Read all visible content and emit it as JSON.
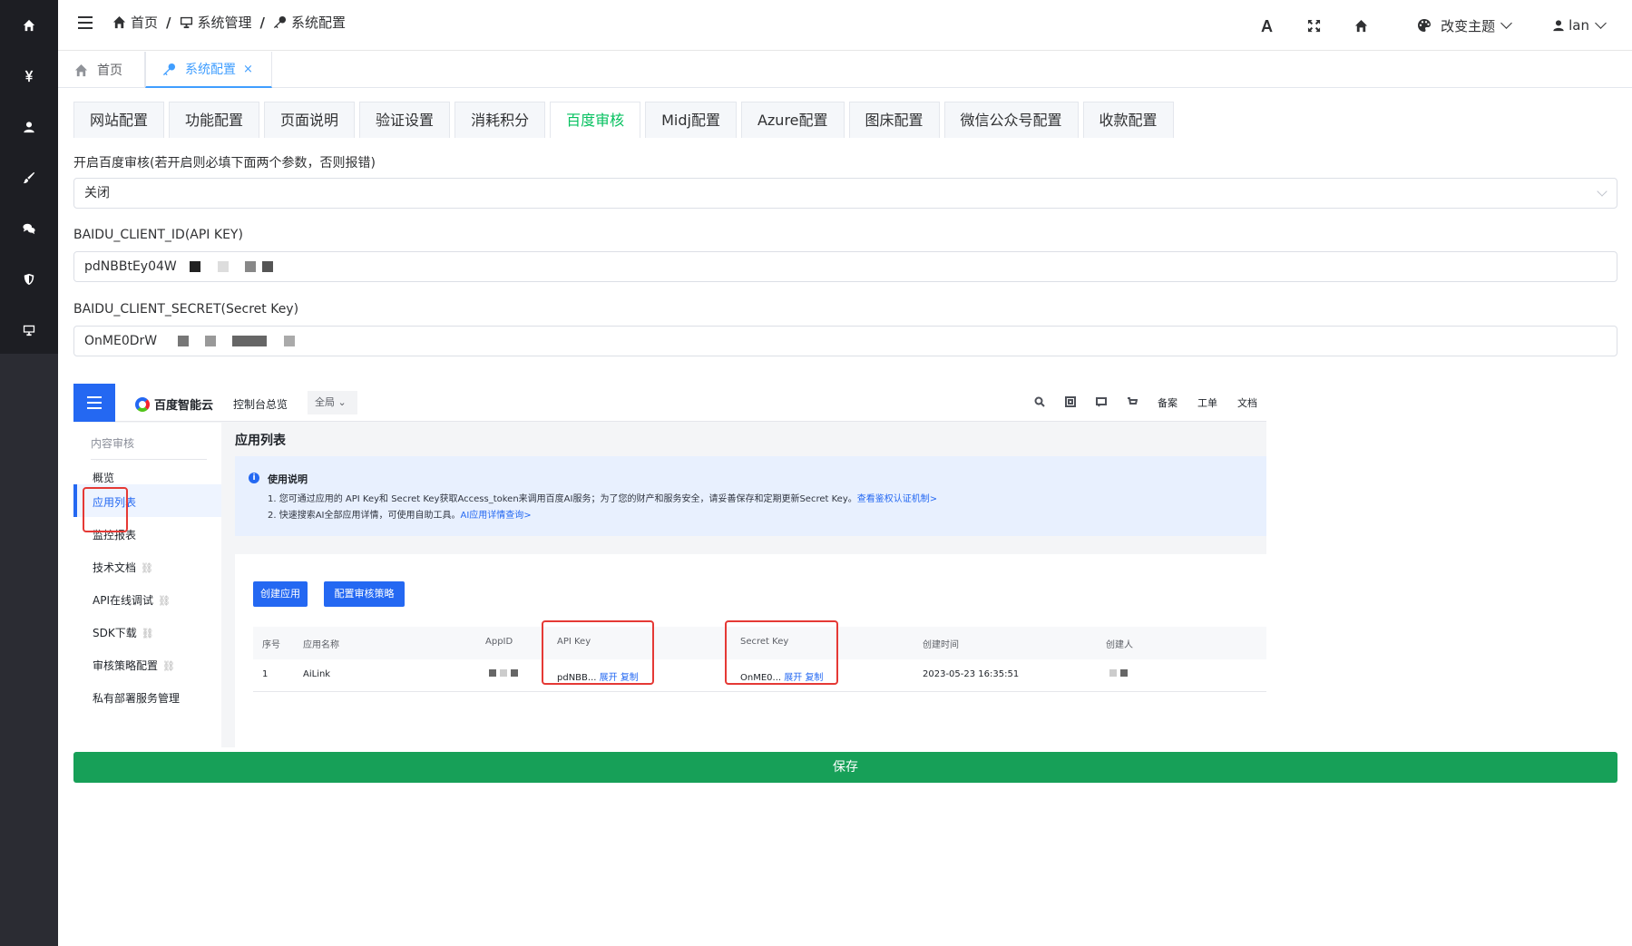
{
  "header": {
    "breadcrumb": [
      "首页",
      "系统管理",
      "系统配置"
    ],
    "breadcrumb_sep": "/",
    "theme_label": "改变主题",
    "user_name": "lan"
  },
  "tags": {
    "home": "首页",
    "active": "系统配置",
    "close": "×"
  },
  "tabs": [
    "网站配置",
    "功能配置",
    "页面说明",
    "验证设置",
    "消耗积分",
    "百度审核",
    "Midj配置",
    "Azure配置",
    "图床配置",
    "微信公众号配置",
    "收款配置"
  ],
  "active_tab": "百度审核",
  "form": {
    "enable_label": "开启百度审核(若开启则必填下面两个参数，否则报错)",
    "enable_value": "关闭",
    "client_id_label": "BAIDU_CLIENT_ID(API KEY)",
    "client_id_value": "pdNBBtEy04W",
    "client_secret_label": "BAIDU_CLIENT_SECRET(Secret Key)",
    "client_secret_value": "OnME0DrW"
  },
  "embedded": {
    "brand": "百度智能云",
    "console": "控制台总览",
    "region": "全局",
    "top_links": [
      "备案",
      "工单",
      "文档"
    ],
    "side_title": "内容审核",
    "side_items": [
      "概览",
      "应用列表",
      "监控报表",
      "技术文档",
      "API在线调试",
      "SDK下载",
      "审核策略配置",
      "私有部署服务管理"
    ],
    "main_title": "应用列表",
    "notice_title": "使用说明",
    "notice_line1": "1. 您可通过应用的 API Key和 Secret Key获取Access_token来调用百度AI服务；为了您的财产和服务安全，请妥善保存和定期更新Secret Key。",
    "notice_link1": "查看鉴权认证机制>",
    "notice_line2": "2. 快速搜索AI全部应用详情，可使用自助工具。",
    "notice_link2": "AI应用详情查询>",
    "btn_create": "创建应用",
    "btn_policy": "配置审核策略",
    "columns": [
      "序号",
      "应用名称",
      "AppID",
      "API Key",
      "Secret Key",
      "创建时间",
      "创建人"
    ],
    "row": {
      "index": "1",
      "name": "AiLink",
      "api_key": "pdNBB...",
      "secret_key": "OnME0...",
      "expand": "展开",
      "copy": "复制",
      "created": "2023-05-23 16:35:51"
    }
  },
  "save_label": "保存",
  "colors": {
    "accent": "#07c160",
    "save": "#17a058",
    "sidebar": "#1d1e23",
    "baidu_blue": "#2468f2"
  },
  "icons": [
    "home-icon",
    "yen-icon",
    "user-icon",
    "brush-icon",
    "chat-icon",
    "shield-icon",
    "monitor-icon",
    "key-icon",
    "font-icon",
    "fullscreen-icon",
    "palette-icon"
  ]
}
